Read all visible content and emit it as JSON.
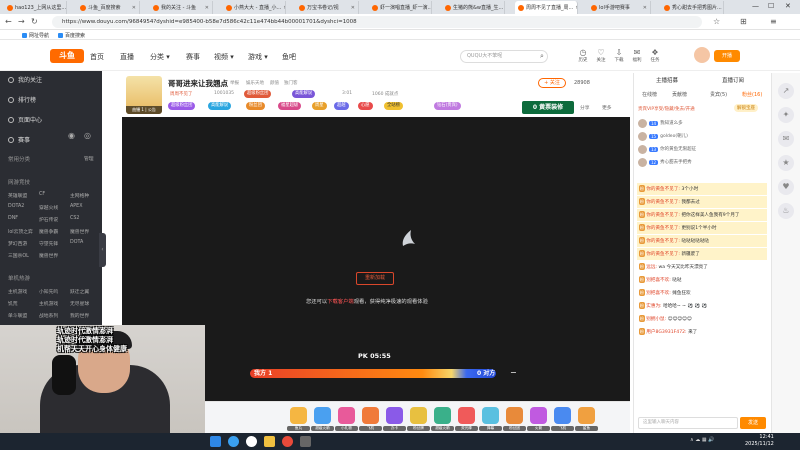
{
  "browser": {
    "tabs": [
      "hao123_上网从这里...",
      "斗鱼_百度搜索",
      "我的关注 - 斗鱼",
      "小燕大大 - 直播_小...",
      "万宝书卷记/视",
      "虾一演唱直播_虾一演...",
      "生猪的熊&w直播_生...",
      "周周不见了直播_周...",
      "lol手游吧赛事",
      "秀心甜去手把秀图片..."
    ],
    "active_tab_index": 7,
    "url": "https://www.douyu.com/9684954?dyshid=e985400-b58e7d586c42c11e474bb44b00001701&dyshci=1008",
    "bookmarks": [
      "网址导航",
      "百度搜索"
    ]
  },
  "site": {
    "logo": "斗鱼",
    "nav": [
      "首页",
      "直播",
      "分类 ▾",
      "赛事",
      "视频 ▾",
      "游戏 ▾",
      "鱼吧"
    ],
    "search_placeholder": "QUQU大不笨呢",
    "header_icons": [
      "历史",
      "关注",
      "下载",
      "福利",
      "任务"
    ],
    "kaibo": "开播"
  },
  "sidebar": {
    "items": [
      "我的关注",
      "排行榜",
      "页面中心",
      "赛事"
    ],
    "section_common": "常用分类",
    "section_common_action": "管理",
    "section_games": "网游竞技",
    "games": [
      [
        "英雄联盟",
        "CF",
        "主网格种"
      ],
      [
        "DOTA2",
        "穿越火线",
        "APEX"
      ],
      [
        "DNF",
        "炉石传说",
        "CS2"
      ],
      [
        "lol云顶之弈",
        "魔兽争霸",
        "魔兽世界"
      ],
      [
        "梦幻西游",
        "守望先锋",
        "DOTA"
      ],
      [
        "三国杀OL",
        "魔兽世界",
        ""
      ]
    ],
    "section_mobile": "单机热游",
    "mobile": [
      [
        "主机游戏",
        "小知先鸣",
        "跃迁之翼"
      ],
      [
        "饥荒",
        "主机游戏",
        "无尽星球"
      ],
      [
        "单斗联盟",
        "战地系列",
        "我的世界"
      ]
    ]
  },
  "room": {
    "title": "哥哥进来让我翘点",
    "meta": [
      "举报",
      "娱乐天地",
      "颜值",
      "独门客"
    ],
    "anchor_name": "周周不见了",
    "room_id": "1001035",
    "stats": [
      "3:01",
      "1060 成就点"
    ],
    "badges": [
      "超级粉丝团",
      "高能解说",
      "粉丝团",
      "福星超级",
      "周星",
      "超越",
      "心愿",
      "全站榜",
      "钻石(贵宾)"
    ],
    "follow": "+ 关注",
    "fans": "28908",
    "banner": "0 黄票装修",
    "links": [
      "分享",
      "更多"
    ],
    "anchor_level": "曲鳗 1 | 公告"
  },
  "player": {
    "retry": "重新加载",
    "hint_prefix": "您还可以",
    "hint_link": "下载客户端",
    "hint_suffix": "观看，获得纯净极速的观看体验",
    "pk_time": "PK 05:55",
    "pk_left": "我方 1",
    "pk_right": "0 对方"
  },
  "gifts": [
    "鱼丸",
    "超级火箭",
    "小礼物",
    "飞机",
    "办卡",
    "粉丝牌",
    "超级火箭",
    "荧光棒",
    "弹幕",
    "粉丝团",
    "火箭",
    "飞机",
    "鲨鱼"
  ],
  "webcam_overlay": [
    "轨迹时代激情澎湃",
    "轨迹时代激情澎湃",
    "机帮天天开心身体健康"
  ],
  "chat": {
    "tabs": [
      "主播招募",
      "直播订阅"
    ],
    "subtabs": [
      "在线榜",
      "贡献榜",
      "贵宾(5)",
      "粉丝(16)"
    ],
    "notice": "贵宾VIP享受/隐藏/免去/开通",
    "unlock": "解锁宝座",
    "ranks": [
      {
        "lvl": "14",
        "name": "我知道么多"
      },
      {
        "lvl": "15",
        "name": "goldeo(朝儿)"
      },
      {
        "lvl": "13",
        "name": "你的黄鱼无限超征"
      },
      {
        "lvl": "12",
        "name": "秀心甜去手把秀"
      }
    ],
    "messages": [
      {
        "name": "你的黄鱼不见了:",
        "text": "3个小时",
        "hl": true
      },
      {
        "name": "你的黄鱼不见了:",
        "text": "我都去过",
        "hl": true
      },
      {
        "name": "你的黄鱼不见了:",
        "text": "把你这样美人鱼我有9个月了",
        "hl": true
      },
      {
        "name": "你的黄鱼不见了:",
        "text": "更别说1个半小时",
        "hl": true
      },
      {
        "name": "你的黄鱼不见了:",
        "text": "哒哒哒哒哒哒",
        "hl": true
      },
      {
        "name": "你的黄鱼不见了:",
        "text": "新疆废了",
        "hl": true
      },
      {
        "name": "远远:",
        "text": "wa 今天又比昨天漂亮了",
        "hl": false
      },
      {
        "name": "別把喜不欢:",
        "text": "哒哒",
        "hl": false
      },
      {
        "name": "別把喜不欢:",
        "text": "摊鱼狂欢",
        "hl": false
      },
      {
        "name": "实惠为:",
        "text": "哈哈哈~ ~ ⚽ ⚽ ⚽",
        "hl": false
      },
      {
        "name": "别拥小鼠:",
        "text": "😊😊😊😊😊",
        "hl": false
      },
      {
        "name": "用户8G3931F472:",
        "text": "来了",
        "hl": false
      }
    ],
    "input_placeholder": "这里输入聊天内容",
    "send": "发送"
  },
  "taskbar": {
    "time": "12:41",
    "date": "2025/11/12"
  }
}
